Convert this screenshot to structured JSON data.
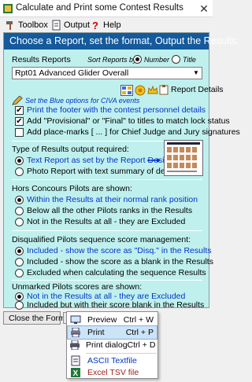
{
  "window": {
    "title": "Calculate and Print some Contest Results",
    "close_glyph": "✕"
  },
  "menu": [
    {
      "label": "Toolbox",
      "icon": "hammer-icon"
    },
    {
      "label": "Output",
      "icon": "document-icon"
    },
    {
      "label": "Help",
      "icon": "question-icon"
    }
  ],
  "header": "Choose a Report, set the format, Output the Results:",
  "reports": {
    "label": "Results Reports",
    "sort_by": "Sort Reports by:",
    "sort_number": "Number",
    "sort_title": "Title",
    "selected": "Rpt01  Advanced Glider Overall",
    "report_details": "Report Details",
    "civa_hint": "Set the Blue options for CIVA events"
  },
  "options": {
    "print_footer": "Print the footer with the contest personnel details",
    "add_provisional": "Add \"Provisional\" or \"Final\" to titles to match lock status",
    "add_placemarks": "Add place-marks [ ... ] for Chief Judge and Jury signatures"
  },
  "output_type": {
    "label": "Type of Results output required:",
    "text_report": "Text Report as set by the Report Designer",
    "photo_report": "Photo Report with text summary of details"
  },
  "hors_concours": {
    "label": "Hors Concours Pilots are shown:",
    "opt1": "Within the Results at their normal rank position",
    "opt2": "Below all the other Pilots ranks in the Results",
    "opt3": "Not in the Results at all - they are Excluded"
  },
  "disqualified": {
    "label": "Disqualified Pilots sequence score management:",
    "opt1": "Included - show the score as \"Disq.\" in the Results",
    "opt2": "Included - show the score as a blank in the Results",
    "opt3": "Excluded when calculating the sequence Results"
  },
  "unmarked": {
    "label": "Unmarked Pilots scores are shown:",
    "opt1": "Not in the Results at all - they are Excluded",
    "opt2": "Included but with their score blank in the Results"
  },
  "footer": {
    "close_label": "Close the Form"
  },
  "popup": [
    {
      "label": "Preview",
      "key": "Ctrl + W",
      "icon": "monitor-icon"
    },
    {
      "label": "Print",
      "key": "Ctrl + P",
      "icon": "printer-icon"
    },
    {
      "label": "Print dialog",
      "key": "Ctrl + D",
      "icon": "printer-dialog-icon"
    },
    {
      "label": "ASCII Textfile",
      "key": "",
      "icon": "text-file-icon"
    },
    {
      "label": "Excel TSV file",
      "key": "",
      "icon": "excel-icon"
    }
  ],
  "colors": {
    "panel_bg": "#bff0ee",
    "header_bg": "#145a9c",
    "accent_blue": "#0033cc"
  }
}
